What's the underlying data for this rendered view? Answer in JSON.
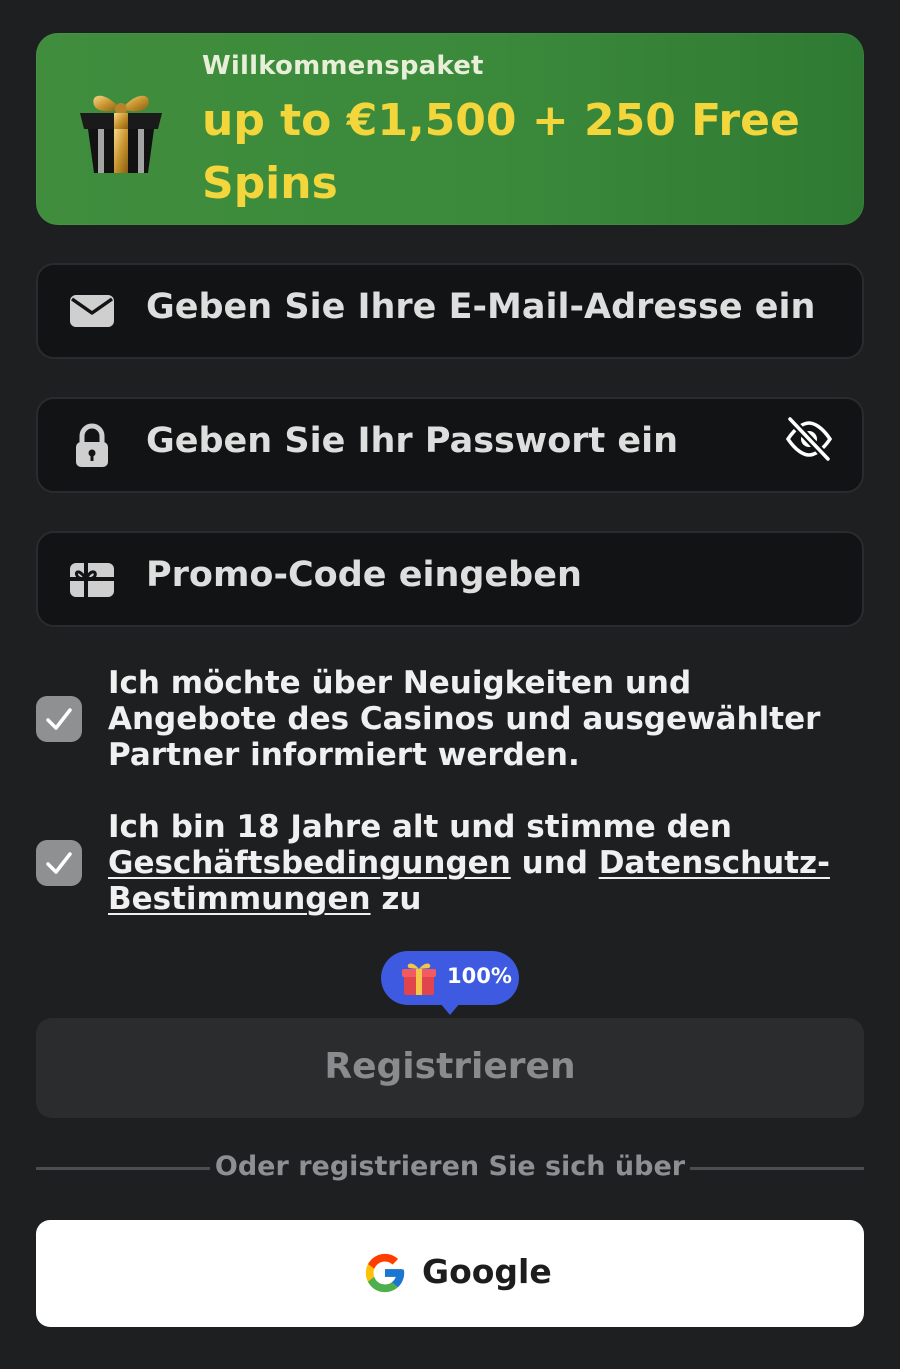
{
  "banner": {
    "kicker": "Willkommenspaket",
    "offer": "up to €1,500 + 250 Free Spins",
    "icon": "gift-box-icon"
  },
  "form": {
    "email": {
      "placeholder": "Geben Sie Ihre E-Mail-Adresse ein",
      "icon": "envelope-icon"
    },
    "password": {
      "placeholder": "Geben Sie Ihr Passwort ein",
      "icon": "lock-icon",
      "toggle_icon": "eye-off-icon"
    },
    "promo": {
      "placeholder": "Promo-Code eingeben",
      "icon": "gift-card-icon"
    }
  },
  "consents": {
    "newsletter": {
      "checked": true,
      "text": "Ich möchte über Neuigkeiten und Angebote des Casinos und ausgewählter Partner informiert werden."
    },
    "terms": {
      "checked": true,
      "prefix": "Ich bin 18 Jahre alt und stimme den",
      "link1": "Geschäftsbedingungen",
      "middle": "und",
      "link2": "Datenschutz-Bestimmungen",
      "suffix": "zu"
    }
  },
  "bonus_badge": {
    "label": "100%",
    "icon": "gift-icon"
  },
  "register_button": {
    "label": "Registrieren"
  },
  "divider": {
    "text": "Oder registrieren Sie sich über"
  },
  "google_button": {
    "label": "Google",
    "icon": "google-g-icon"
  },
  "colors": {
    "background": "#1e1f21",
    "banner_green": "#3d8b3c",
    "offer_yellow": "#f3d63c",
    "input_bg": "#121314",
    "badge_blue": "#3d5ae0"
  }
}
